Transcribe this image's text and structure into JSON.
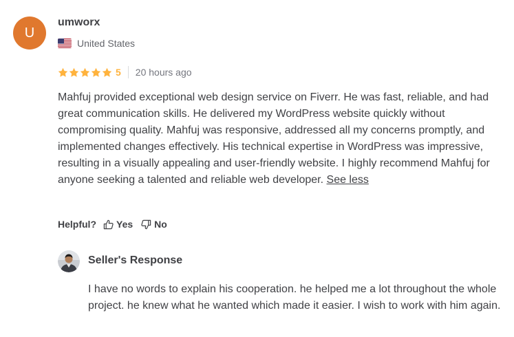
{
  "review": {
    "avatar_initial": "U",
    "avatar_color": "#e0782e",
    "username": "umworx",
    "country": "United States",
    "country_flag_icon": "us-flag-icon",
    "rating": 5,
    "rating_label": "5",
    "star_icon": "star-icon",
    "star_color": "#ffb33e",
    "time_ago": "20 hours ago",
    "text": "Mahfuj provided exceptional web design service on Fiverr. He was fast, reliable, and had great communication skills. He delivered my WordPress website quickly without compromising quality. Mahfuj was responsive, addressed all my concerns promptly, and implemented changes effectively. His technical expertise in WordPress was impressive, resulting in a visually appealing and user-friendly website. I highly recommend Mahfuj for anyone seeking a talented and reliable web developer.",
    "see_less_label": "See less"
  },
  "helpful": {
    "label": "Helpful?",
    "yes_label": "Yes",
    "no_label": "No",
    "yes_icon": "thumbs-up-icon",
    "no_icon": "thumbs-down-icon"
  },
  "seller_response": {
    "title": "Seller's Response",
    "text": "I have no words to explain his cooperation. he helped me a lot throughout the whole project. he knew what he wanted which made it easier. I wish to work with him again."
  }
}
